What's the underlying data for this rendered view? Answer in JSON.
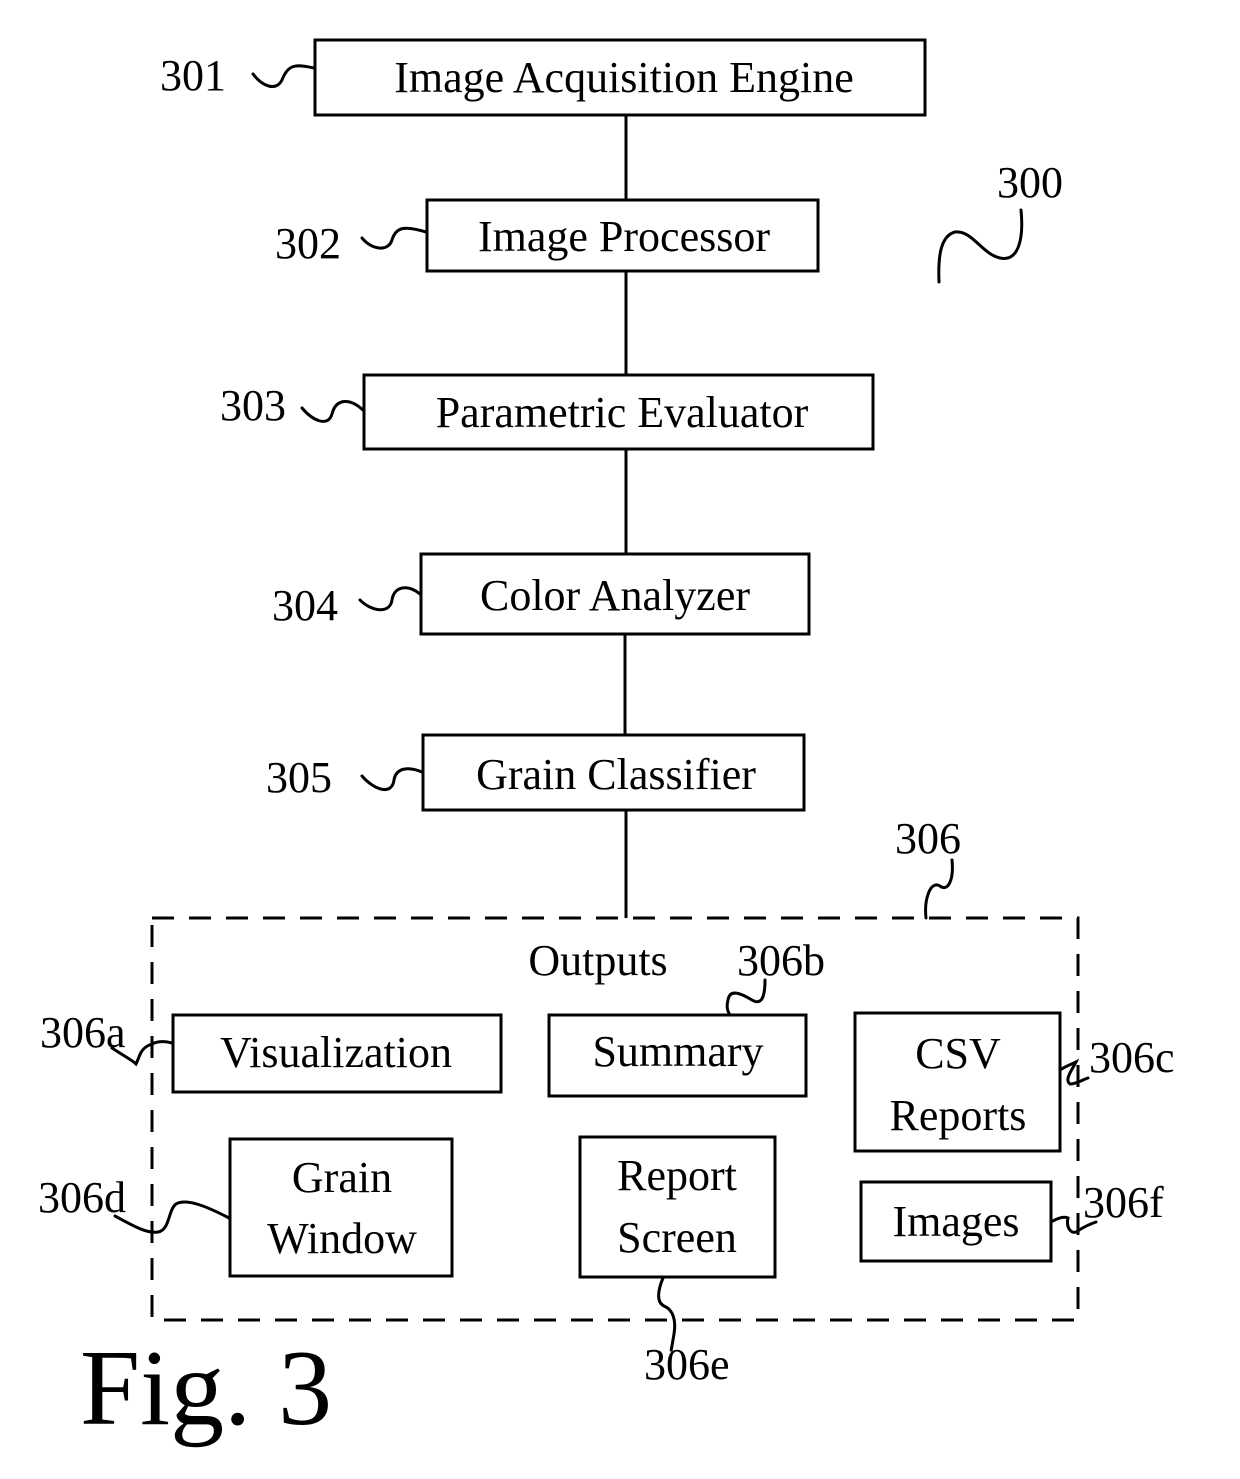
{
  "figure": {
    "caption": "Fig. 3",
    "system_ref": "300"
  },
  "pipeline": [
    {
      "ref": "301",
      "label": "Image Acquisition Engine"
    },
    {
      "ref": "302",
      "label": "Image Processor"
    },
    {
      "ref": "303",
      "label": "Parametric Evaluator"
    },
    {
      "ref": "304",
      "label": "Color Analyzer"
    },
    {
      "ref": "305",
      "label": "Grain Classifier"
    }
  ],
  "outputs": {
    "ref": "306",
    "title": "Outputs",
    "items": [
      {
        "ref": "306a",
        "lines": [
          "Visualization"
        ]
      },
      {
        "ref": "306b",
        "lines": [
          "Summary"
        ]
      },
      {
        "ref": "306c",
        "lines": [
          "CSV",
          "Reports"
        ]
      },
      {
        "ref": "306d",
        "lines": [
          "Grain",
          "Window"
        ]
      },
      {
        "ref": "306e",
        "lines": [
          "Report",
          "Screen"
        ]
      },
      {
        "ref": "306f",
        "lines": [
          "Images"
        ]
      }
    ]
  }
}
